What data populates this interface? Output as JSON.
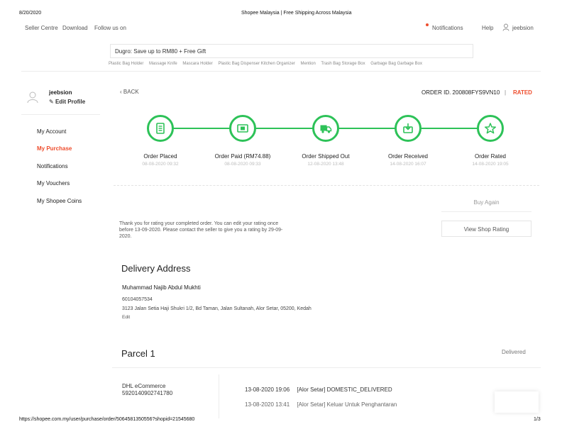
{
  "print_header": {
    "date": "8/20/2020",
    "title": "Shopee Malaysia | Free Shipping Across Malaysia",
    "url": "https://shopee.com.my/user/purchase/order/5064581350556?shopid=21545680",
    "page": "1/3"
  },
  "topnav": {
    "seller_centre": "Seller Centre",
    "download": "Download",
    "follow_us": "Follow us on",
    "notifications": "Notifications",
    "help": "Help",
    "username": "jeebsion"
  },
  "search": {
    "value": "Dugro: Save up to RM80 + Free Gift",
    "suggestions": [
      "Plastic Bag Holder",
      "Massage Knife",
      "Mascara Holder",
      "Plastic Bag Dispenser Kitchen Organizer",
      "Mention",
      "Trash Bag Storage Box",
      "Garbage Bag Garbage Box"
    ]
  },
  "sidebar": {
    "username": "jeebsion",
    "edit_profile": "Edit Profile",
    "items": [
      "My Account",
      "My Purchase",
      "Notifications",
      "My Vouchers",
      "My Shopee Coins"
    ]
  },
  "order": {
    "back": "BACK",
    "order_id": "ORDER ID. 200808FYS9VN10",
    "separator": "|",
    "status": "RATED",
    "steps": [
      {
        "label": "Order Placed",
        "time": "08-08-2020 09:32",
        "icon": "receipt-icon"
      },
      {
        "label": "Order Paid (RM74.88)",
        "time": "08-08-2020 09:33",
        "icon": "money-icon"
      },
      {
        "label": "Order Shipped Out",
        "time": "12-08-2020 13:48",
        "icon": "truck-icon"
      },
      {
        "label": "Order Received",
        "time": "14-08-2020 16:07",
        "icon": "inbox-icon"
      },
      {
        "label": "Order Rated",
        "time": "14-08-2020 19:05",
        "icon": "star-icon"
      }
    ],
    "buy_again": "Buy Again",
    "rating_message": "Thank you for rating your completed order. You can edit your rating once before 13-09-2020. Please contact the seller to give you a rating by 29-09-2020.",
    "view_rating": "View Shop Rating"
  },
  "delivery": {
    "title": "Delivery Address",
    "name": "Muhammad Najib Abdul Mukhti",
    "phone": "60104057534",
    "address": "3123 Jalan Setia Haji Shukri 1/2, Bd Taman, Jalan Sultanah, Alor Setar, 05200, Kedah",
    "edit": "Edit"
  },
  "parcel": {
    "title": "Parcel 1",
    "status": "Delivered",
    "carrier": "DHL eCommerce",
    "tracking_no": "5920140902741780",
    "events": [
      {
        "time": "13-08-2020 19:06",
        "text": "[Alor Setar] DOMESTIC_DELIVERED"
      },
      {
        "time": "13-08-2020 13:41",
        "text": "[Alor Setar] Keluar Untuk Penghantaran"
      }
    ]
  },
  "colors": {
    "brand": "#ee4d2d",
    "success": "#2dc258"
  }
}
